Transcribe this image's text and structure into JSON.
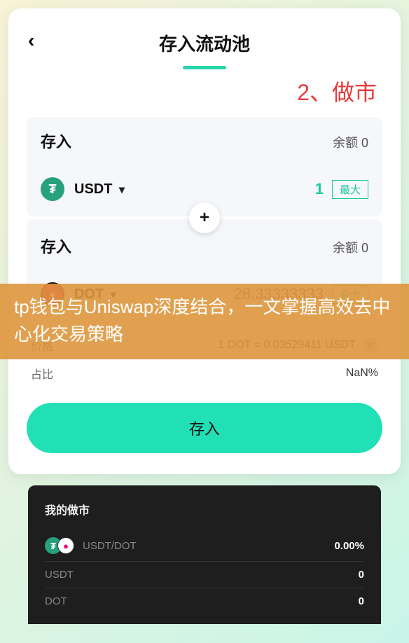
{
  "header": {
    "title": "存入流动池"
  },
  "annotation": "2、做市",
  "deposit1": {
    "label": "存入",
    "balance_label": "余额",
    "balance_value": "0",
    "token": "USDT",
    "amount": "1",
    "max_label": "最大"
  },
  "deposit2": {
    "label": "存入",
    "balance_label": "余额",
    "balance_value": "0",
    "token": "DOT",
    "amount": "28.33333333",
    "max_label": "最大"
  },
  "info": {
    "price_label": "价格",
    "price_value": "1 DOT = 0.03529411 USDT",
    "ratio_label": "占比",
    "ratio_value": "NaN%"
  },
  "submit_label": "存入",
  "my_mm": {
    "title": "我的做市",
    "pair_label": "USDT/DOT",
    "pair_value": "0.00%",
    "rows": [
      {
        "label": "USDT",
        "value": "0"
      },
      {
        "label": "DOT",
        "value": "0"
      }
    ]
  },
  "overlay_text": "tp钱包与Uniswap深度结合，一文掌握高效去中心化交易策略"
}
